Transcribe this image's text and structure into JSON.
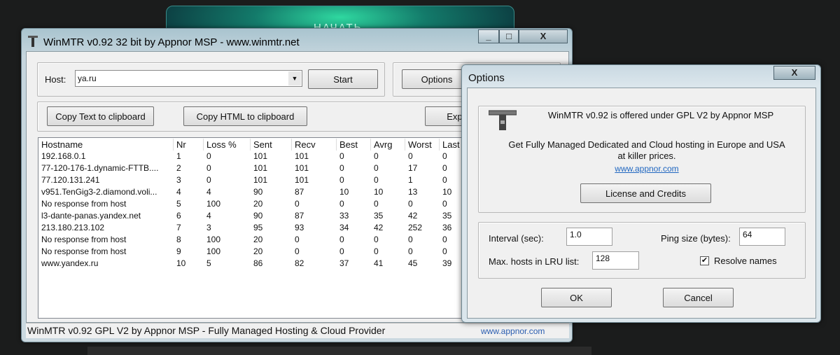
{
  "background_app": {
    "label": "НАЧАТЬ"
  },
  "main_window": {
    "title": "WinMTR v0.92 32 bit by Appnor MSP - www.winmtr.net",
    "minimize": "_",
    "maximize": "□",
    "close": "X",
    "host_label": "Host:",
    "host_value": "ya.ru",
    "start_label": "Start",
    "options_label": "Options",
    "copy_text_label": "Copy Text to clipboard",
    "copy_html_label": "Copy HTML to clipboard",
    "export_label": "Export",
    "columns": [
      "Hostname",
      "Nr",
      "Loss %",
      "Sent",
      "Recv",
      "Best",
      "Avrg",
      "Worst",
      "Last"
    ],
    "rows": [
      [
        "192.168.0.1",
        "1",
        "0",
        "101",
        "101",
        "0",
        "0",
        "0",
        "0"
      ],
      [
        "77-120-176-1.dynamic-FTTB....",
        "2",
        "0",
        "101",
        "101",
        "0",
        "0",
        "17",
        "0"
      ],
      [
        "77.120.131.241",
        "3",
        "0",
        "101",
        "101",
        "0",
        "0",
        "1",
        "0"
      ],
      [
        "v951.TenGig3-2.diamond.voli...",
        "4",
        "4",
        "90",
        "87",
        "10",
        "10",
        "13",
        "10"
      ],
      [
        "No response from host",
        "5",
        "100",
        "20",
        "0",
        "0",
        "0",
        "0",
        "0"
      ],
      [
        "l3-dante-panas.yandex.net",
        "6",
        "4",
        "90",
        "87",
        "33",
        "35",
        "42",
        "35"
      ],
      [
        "213.180.213.102",
        "7",
        "3",
        "95",
        "93",
        "34",
        "42",
        "252",
        "36"
      ],
      [
        "No response from host",
        "8",
        "100",
        "20",
        "0",
        "0",
        "0",
        "0",
        "0"
      ],
      [
        "No response from host",
        "9",
        "100",
        "20",
        "0",
        "0",
        "0",
        "0",
        "0"
      ],
      [
        "www.yandex.ru",
        "10",
        "5",
        "86",
        "82",
        "37",
        "41",
        "45",
        "39"
      ]
    ],
    "status_text": "WinMTR v0.92 GPL V2 by Appnor MSP - Fully Managed Hosting & Cloud Provider",
    "status_link": "www.appnor.com"
  },
  "options_dialog": {
    "title": "Options",
    "close": "X",
    "line1": "WinMTR v0.92 is offered under GPL V2 by Appnor MSP",
    "line2": "Get Fully Managed Dedicated and Cloud hosting in Europe and USA at killer prices.",
    "link": "www.appnor.com",
    "license_label": "License and Credits",
    "interval_label": "Interval (sec):",
    "interval_value": "1.0",
    "ping_size_label": "Ping size (bytes):",
    "ping_size_value": "64",
    "max_hosts_label": "Max. hosts in LRU list:",
    "max_hosts_value": "128",
    "resolve_label": "Resolve names",
    "resolve_checked": true,
    "ok_label": "OK",
    "cancel_label": "Cancel"
  }
}
